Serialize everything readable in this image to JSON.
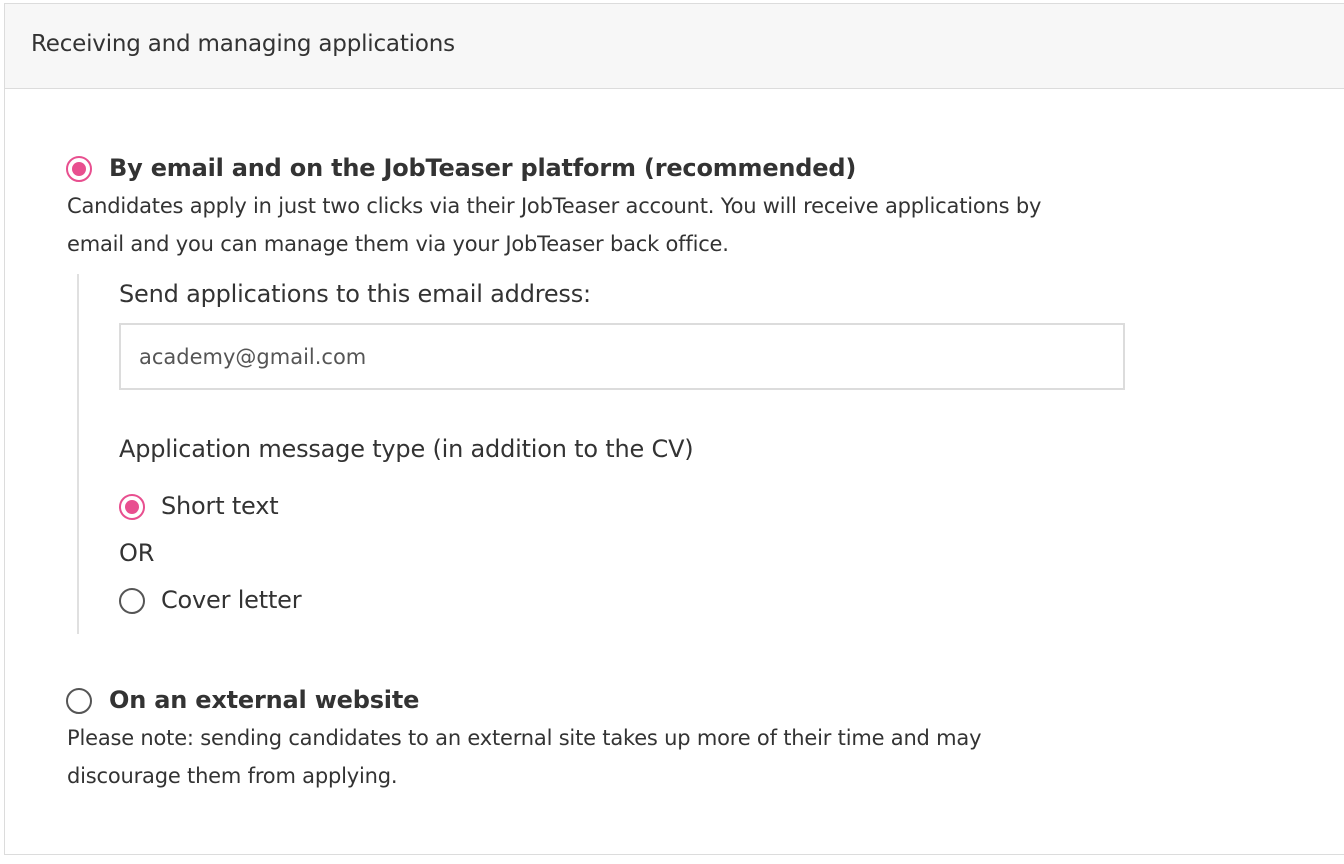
{
  "section": {
    "title": "Receiving and managing applications"
  },
  "option_platform": {
    "title": "By email and on the JobTeaser platform (recommended)",
    "desc_line1": "Candidates apply in just two clicks via their JobTeaser account. You will receive applications by",
    "desc_line2": "email and you can manage them via your JobTeaser back office.",
    "selected": true,
    "email_label": "Send applications to this email address:",
    "email_value": "academy@gmail.com",
    "message_type_label": "Application message type (in addition to the CV)",
    "message_options": {
      "short_text": "Short text",
      "or": "OR",
      "cover_letter": "Cover letter"
    }
  },
  "option_external": {
    "title": "On an external website",
    "desc_line1": "Please note: sending candidates to an external site takes up more of their time and may",
    "desc_line2": "discourage them from applying.",
    "selected": false
  },
  "colors": {
    "accent": "#e84f8f",
    "border": "#dcdcdc",
    "header_bg": "#f7f7f7"
  }
}
